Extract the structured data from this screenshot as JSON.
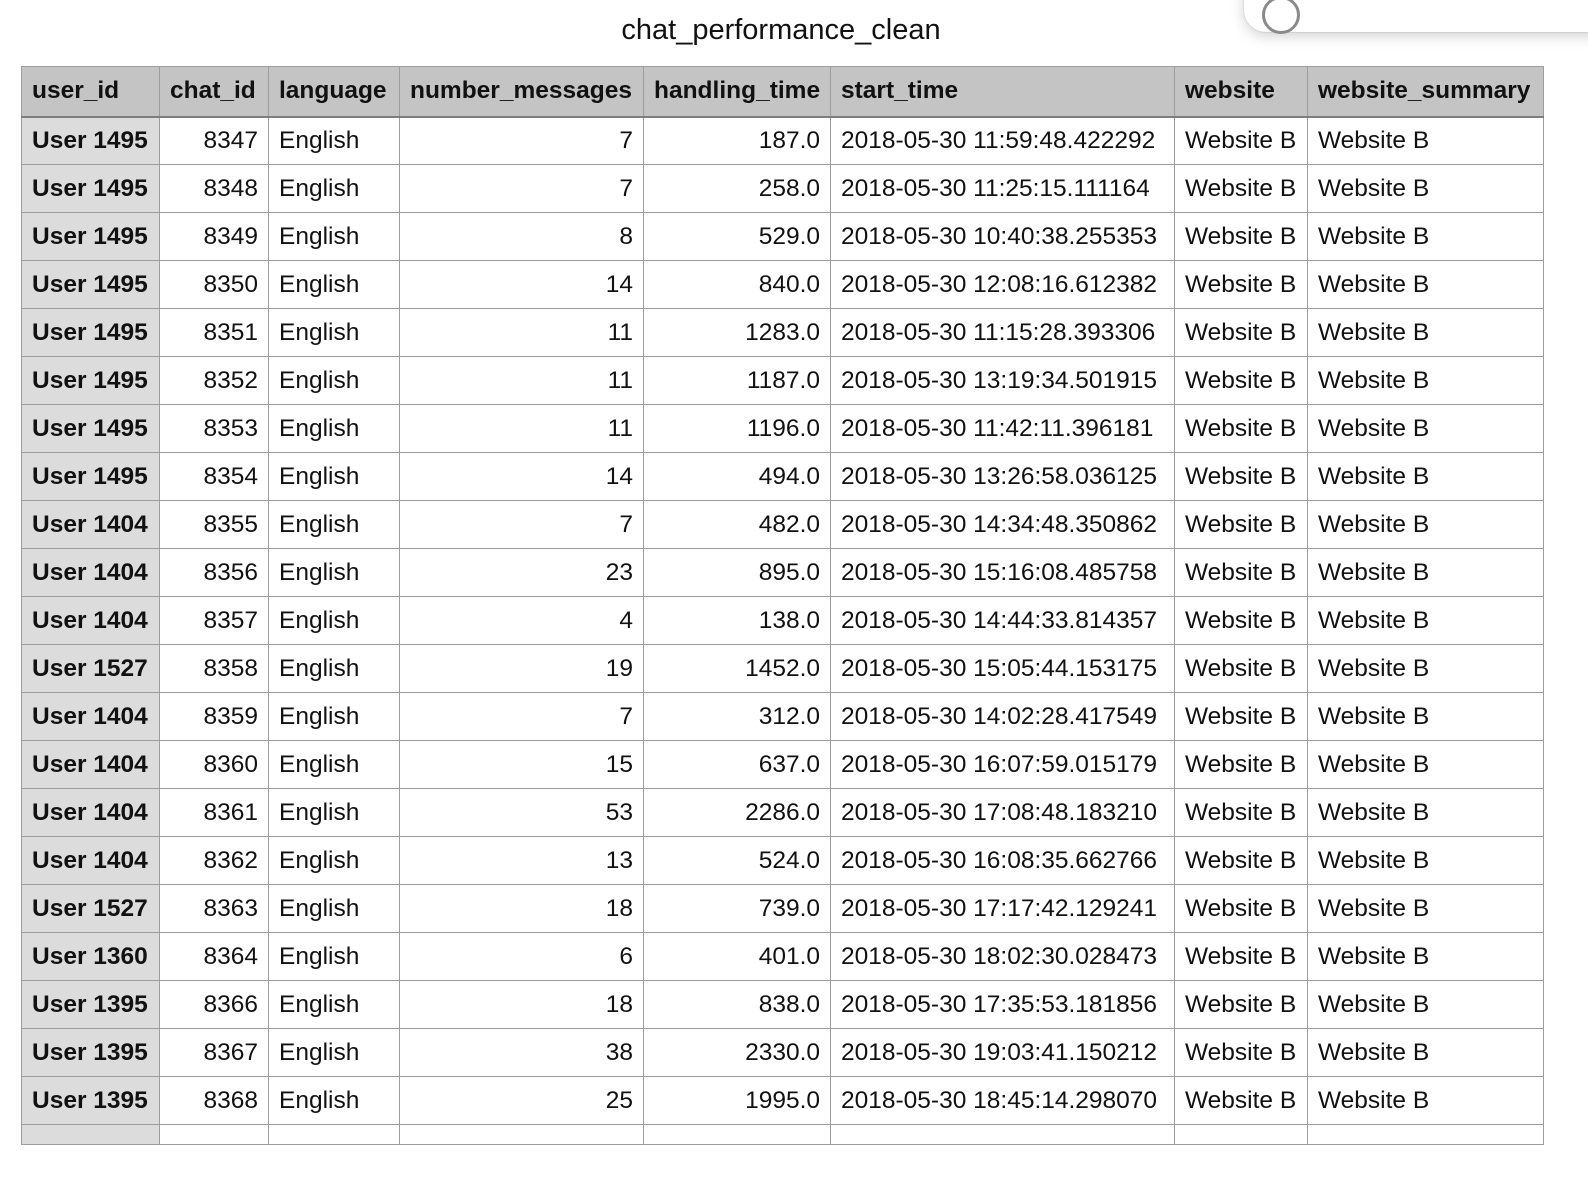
{
  "sheet": {
    "title": "chat_performance_clean",
    "columns": [
      "user_id",
      "chat_id",
      "language",
      "number_messages",
      "handling_time",
      "start_time",
      "website",
      "website_summary"
    ],
    "rows": [
      [
        "User 1495",
        "8347",
        "English",
        "7",
        "187.0",
        "2018-05-30 11:59:48.422292",
        "Website B",
        "Website B"
      ],
      [
        "User 1495",
        "8348",
        "English",
        "7",
        "258.0",
        "2018-05-30 11:25:15.111164",
        "Website B",
        "Website B"
      ],
      [
        "User 1495",
        "8349",
        "English",
        "8",
        "529.0",
        "2018-05-30 10:40:38.255353",
        "Website B",
        "Website B"
      ],
      [
        "User 1495",
        "8350",
        "English",
        "14",
        "840.0",
        "2018-05-30 12:08:16.612382",
        "Website B",
        "Website B"
      ],
      [
        "User 1495",
        "8351",
        "English",
        "11",
        "1283.0",
        "2018-05-30 11:15:28.393306",
        "Website B",
        "Website B"
      ],
      [
        "User 1495",
        "8352",
        "English",
        "11",
        "1187.0",
        "2018-05-30 13:19:34.501915",
        "Website B",
        "Website B"
      ],
      [
        "User 1495",
        "8353",
        "English",
        "11",
        "1196.0",
        "2018-05-30 11:42:11.396181",
        "Website B",
        "Website B"
      ],
      [
        "User 1495",
        "8354",
        "English",
        "14",
        "494.0",
        "2018-05-30 13:26:58.036125",
        "Website B",
        "Website B"
      ],
      [
        "User 1404",
        "8355",
        "English",
        "7",
        "482.0",
        "2018-05-30 14:34:48.350862",
        "Website B",
        "Website B"
      ],
      [
        "User 1404",
        "8356",
        "English",
        "23",
        "895.0",
        "2018-05-30 15:16:08.485758",
        "Website B",
        "Website B"
      ],
      [
        "User 1404",
        "8357",
        "English",
        "4",
        "138.0",
        "2018-05-30 14:44:33.814357",
        "Website B",
        "Website B"
      ],
      [
        "User 1527",
        "8358",
        "English",
        "19",
        "1452.0",
        "2018-05-30 15:05:44.153175",
        "Website B",
        "Website B"
      ],
      [
        "User 1404",
        "8359",
        "English",
        "7",
        "312.0",
        "2018-05-30 14:02:28.417549",
        "Website B",
        "Website B"
      ],
      [
        "User 1404",
        "8360",
        "English",
        "15",
        "637.0",
        "2018-05-30 16:07:59.015179",
        "Website B",
        "Website B"
      ],
      [
        "User 1404",
        "8361",
        "English",
        "53",
        "2286.0",
        "2018-05-30 17:08:48.183210",
        "Website B",
        "Website B"
      ],
      [
        "User 1404",
        "8362",
        "English",
        "13",
        "524.0",
        "2018-05-30 16:08:35.662766",
        "Website B",
        "Website B"
      ],
      [
        "User 1527",
        "8363",
        "English",
        "18",
        "739.0",
        "2018-05-30 17:17:42.129241",
        "Website B",
        "Website B"
      ],
      [
        "User 1360",
        "8364",
        "English",
        "6",
        "401.0",
        "2018-05-30 18:02:30.028473",
        "Website B",
        "Website B"
      ],
      [
        "User 1395",
        "8366",
        "English",
        "18",
        "838.0",
        "2018-05-30 17:35:53.181856",
        "Website B",
        "Website B"
      ],
      [
        "User 1395",
        "8367",
        "English",
        "38",
        "2330.0",
        "2018-05-30 19:03:41.150212",
        "Website B",
        "Website B"
      ],
      [
        "User 1395",
        "8368",
        "English",
        "25",
        "1995.0",
        "2018-05-30 18:45:14.298070",
        "Website B",
        "Website B"
      ]
    ]
  },
  "colors": {
    "header_bg": "#c4c4c4",
    "row_header_bg": "#dcdcdc",
    "grid_line": "#9c9c9c"
  }
}
